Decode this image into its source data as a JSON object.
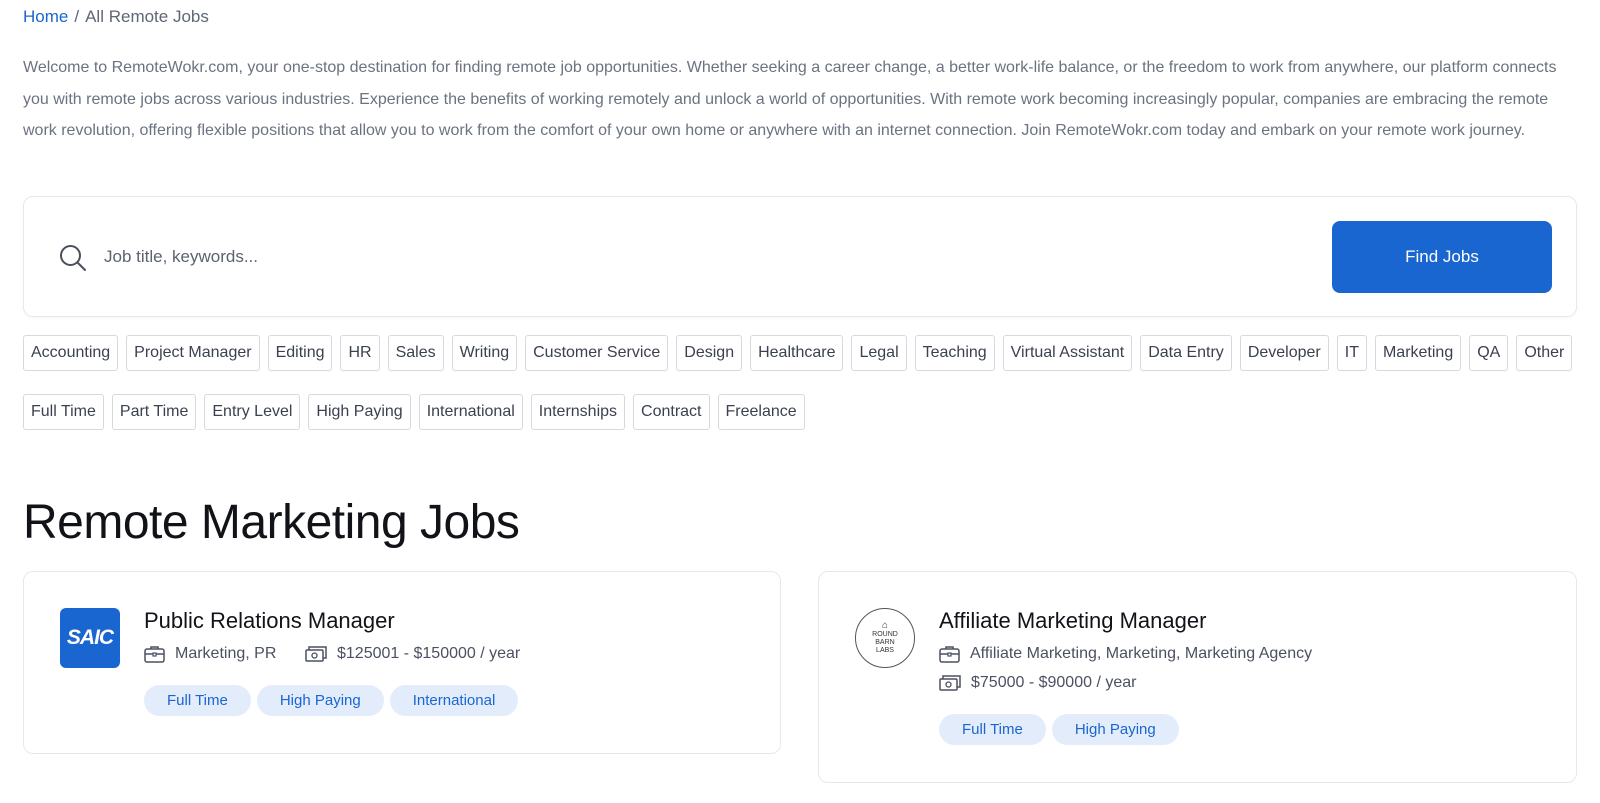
{
  "breadcrumb": {
    "home": "Home",
    "separator": "/",
    "current": "All Remote Jobs"
  },
  "intro": "Welcome to RemoteWokr.com, your one-stop destination for finding remote job opportunities. Whether seeking a career change, a better work-life balance, or the freedom to work from anywhere, our platform connects you with remote jobs across various industries. Experience the benefits of working remotely and unlock a world of opportunities. With remote work becoming increasingly popular, companies are embracing the remote work revolution, offering flexible positions that allow you to work from the comfort of your own home or anywhere with an internet connection. Join RemoteWokr.com today and embark on your remote work journey.",
  "search": {
    "placeholder": "Job title, keywords...",
    "value": "",
    "button": "Find Jobs",
    "icon": "search-icon"
  },
  "categories": [
    "Accounting",
    "Project Manager",
    "Editing",
    "HR",
    "Sales",
    "Writing",
    "Customer Service",
    "Design",
    "Healthcare",
    "Legal",
    "Teaching",
    "Virtual Assistant",
    "Data Entry",
    "Developer",
    "IT",
    "Marketing",
    "QA",
    "Other"
  ],
  "job_types": [
    "Full Time",
    "Part Time",
    "Entry Level",
    "High Paying",
    "International",
    "Internships",
    "Contract",
    "Freelance"
  ],
  "section_title": "Remote Marketing Jobs",
  "jobs": [
    {
      "logo_text": "SAIC",
      "title": "Public Relations Manager",
      "categories": "Marketing, PR",
      "salary": "$125001 - $150000 / year",
      "tags": [
        "Full Time",
        "High Paying",
        "International"
      ]
    },
    {
      "logo_text": [
        "ROUND",
        "BARN",
        "LABS"
      ],
      "title": "Affiliate Marketing Manager",
      "categories": "Affiliate Marketing, Marketing, Marketing Agency",
      "salary": "$75000 - $90000 / year",
      "tags": [
        "Full Time",
        "High Paying"
      ]
    }
  ],
  "colors": {
    "accent": "#1a66d0",
    "badge_bg": "#e3ecfb",
    "text_muted": "#6b7280",
    "border": "#d6d9de"
  },
  "icons": {
    "category": "briefcase-icon",
    "salary": "money-icon"
  }
}
